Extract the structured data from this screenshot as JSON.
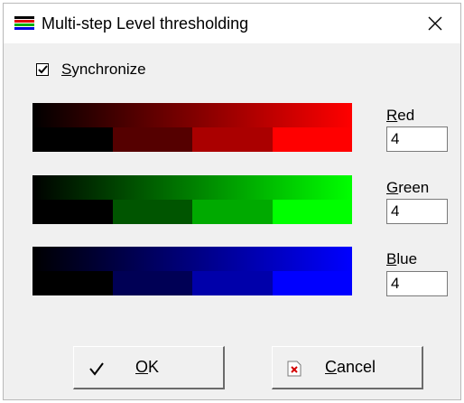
{
  "window": {
    "title": "Multi-step Level thresholding",
    "close_glyph": "✕"
  },
  "synchronize": {
    "label_u": "S",
    "label_rest": "ynchronize",
    "checked": true
  },
  "channels": [
    {
      "name_u": "R",
      "name_rest": "ed",
      "value": "4",
      "color": "#ff0000",
      "steps": [
        "#000000",
        "#550000",
        "#aa0000",
        "#ff0000"
      ]
    },
    {
      "name_u": "G",
      "name_rest": "reen",
      "value": "4",
      "color": "#00ff00",
      "steps": [
        "#000000",
        "#005500",
        "#00aa00",
        "#00ff00"
      ]
    },
    {
      "name_u": "B",
      "name_rest": "lue",
      "value": "4",
      "color": "#0000ff",
      "steps": [
        "#000000",
        "#000055",
        "#0000aa",
        "#0000ff"
      ]
    }
  ],
  "buttons": {
    "ok": {
      "label_u": "O",
      "label_rest": "K",
      "icon": "checkmark-icon"
    },
    "cancel": {
      "label_u": "C",
      "label_rest": "ancel",
      "icon": "cancel-document-icon"
    }
  }
}
